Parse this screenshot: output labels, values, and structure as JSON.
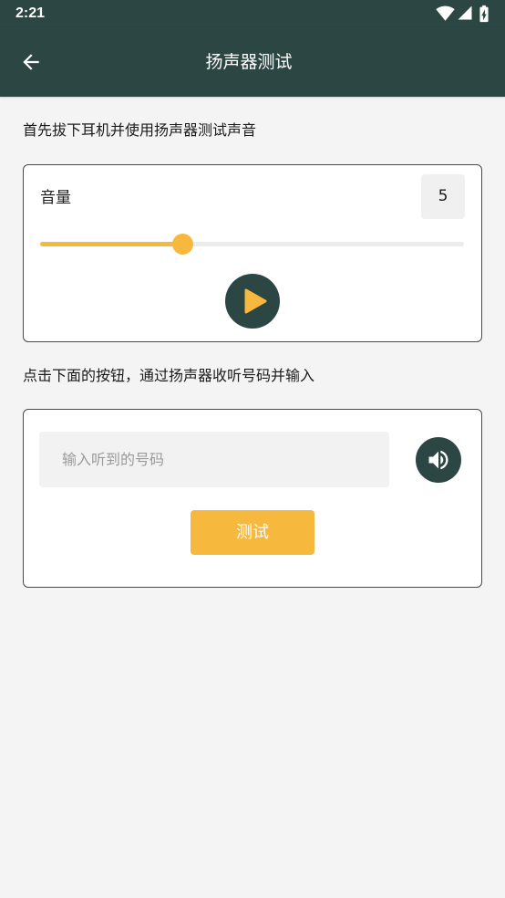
{
  "status_bar": {
    "time": "2:21"
  },
  "app_bar": {
    "title": "扬声器测试"
  },
  "instructions": {
    "first": "首先拔下耳机并使用扬声器测试声音",
    "second": "点击下面的按钮，通过扬声器收听号码并输入"
  },
  "volume_card": {
    "label": "音量",
    "value": "5",
    "level": 0.335
  },
  "number_card": {
    "input_value": "",
    "input_placeholder": "输入听到的号码",
    "test_label": "测试"
  },
  "icons": {
    "back": "back-arrow-icon",
    "wifi": "wifi-icon",
    "signal": "cellular-signal-icon",
    "battery": "battery-charging-icon",
    "play": "play-icon",
    "speaker": "speaker-volume-icon"
  },
  "colors": {
    "primary": "#2c4644",
    "accent": "#f6b93e",
    "background": "#f4f4f4"
  }
}
